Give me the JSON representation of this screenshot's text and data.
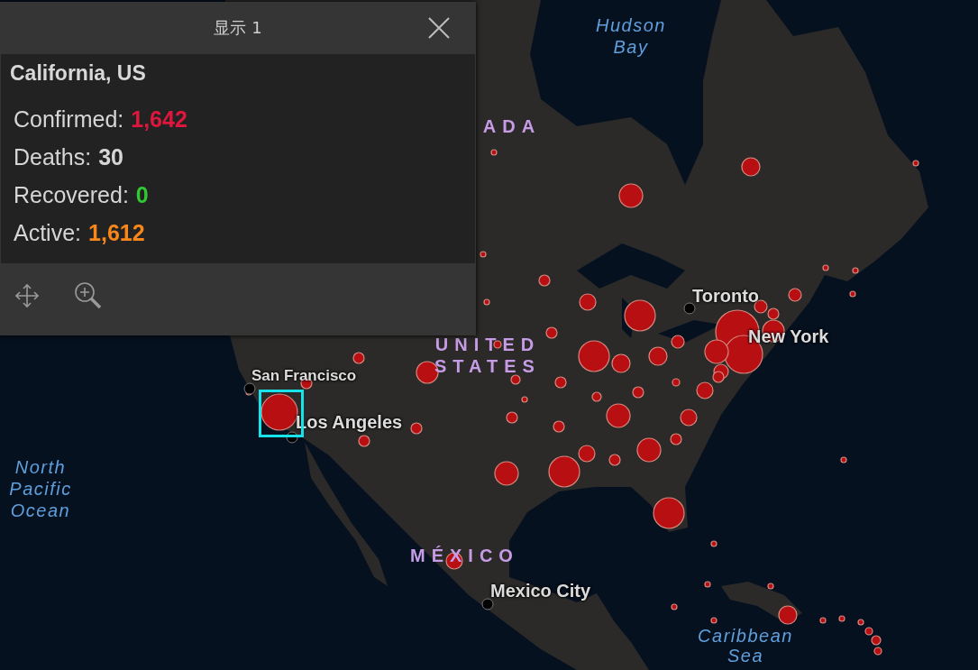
{
  "map": {
    "labels": [
      {
        "text": "Hudson Bay",
        "kind": "water"
      },
      {
        "text": "ADA",
        "kind": "country"
      },
      {
        "text": "Toronto",
        "kind": "city"
      },
      {
        "text": "New York",
        "kind": "city"
      },
      {
        "text": "UNITED STATES",
        "kind": "country"
      },
      {
        "text": "San Francisco",
        "kind": "city"
      },
      {
        "text": "Los Angeles",
        "kind": "city"
      },
      {
        "text": "North Pacific Ocean",
        "kind": "water"
      },
      {
        "text": "MÉXICO",
        "kind": "country"
      },
      {
        "text": "Mexico City",
        "kind": "city"
      },
      {
        "text": "Caribbean Sea",
        "kind": "water"
      }
    ]
  },
  "popup": {
    "title": "显示 1",
    "heading": "California, US",
    "stats": [
      {
        "label": "Confirmed:",
        "value": "1,642",
        "color": "#e0173c"
      },
      {
        "label": "Deaths:",
        "value": "30",
        "color": "#d6d6d6"
      },
      {
        "label": "Recovered:",
        "value": "0",
        "color": "#31c931"
      },
      {
        "label": "Active:",
        "value": "1,612",
        "color": "#f7871a"
      }
    ]
  }
}
